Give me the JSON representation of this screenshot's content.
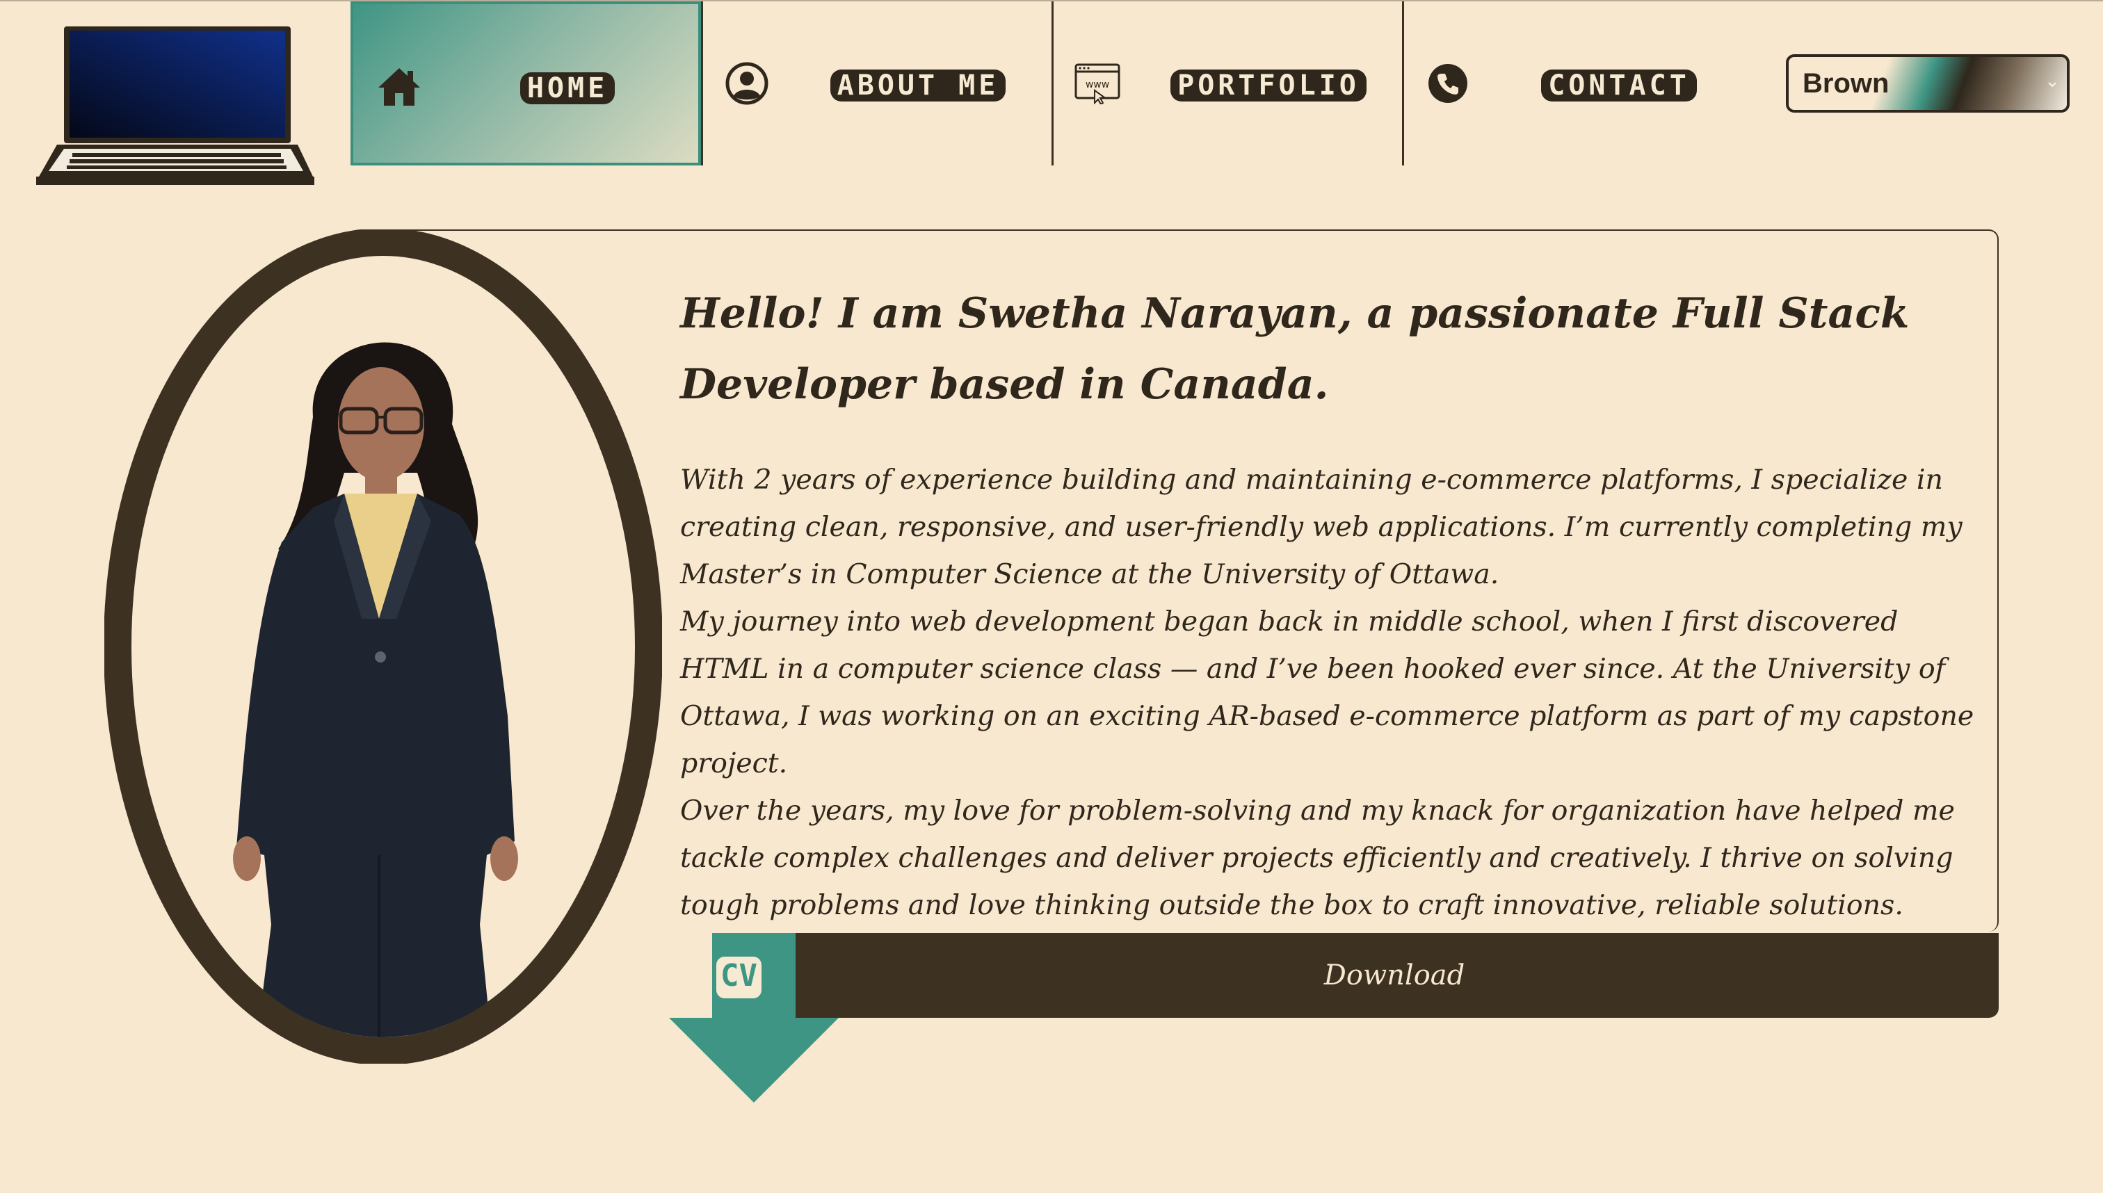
{
  "nav": {
    "items": [
      {
        "label": "Home",
        "icon": "home-icon",
        "active": true
      },
      {
        "label": "About me",
        "icon": "user-circle-icon",
        "active": false
      },
      {
        "label": "Portfolio",
        "icon": "www-browser-icon",
        "active": false
      },
      {
        "label": "Contact",
        "icon": "phone-icon",
        "active": false
      }
    ],
    "theme_select": {
      "value": "Brown"
    }
  },
  "hero": {
    "title": "Hello! I am Swetha Narayan, a passionate Full Stack Developer based in Canada.",
    "paragraphs": [
      "With 2 years of experience building and maintaining e-commerce platforms, I specialize in creating clean, responsive, and user-friendly web applications. I’m currently completing my Master’s in Computer Science at the University of Ottawa.",
      "My journey into web development began back in middle school, when I first discovered HTML in a computer science class — and I’ve been hooked ever since. At the University of Ottawa, I was working on an exciting AR-based e-commerce platform as part of my capstone project.",
      "Over the years, my love for problem-solving and my knack for organization have helped me tackle complex challenges and deliver projects efficiently and creatively. I thrive on solving tough problems and love thinking outside the box to craft innovative, reliable solutions."
    ]
  },
  "cv": {
    "badge": "CV",
    "download_label": "Download"
  },
  "colors": {
    "background": "#f9e8d0",
    "dark_brown": "#3d3222",
    "teal": "#3f9584"
  }
}
